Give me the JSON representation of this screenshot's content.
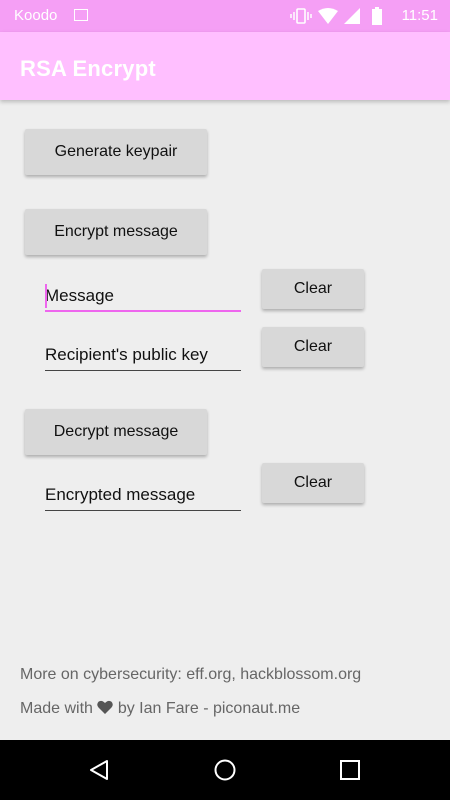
{
  "status_bar": {
    "carrier": "Koodo",
    "time": "11:51"
  },
  "app_bar": {
    "title": "RSA Encrypt"
  },
  "buttons": {
    "generate_keypair": "Generate keypair",
    "encrypt_message": "Encrypt message",
    "decrypt_message": "Decrypt message",
    "clear": "Clear"
  },
  "fields": {
    "message": "Message",
    "recipient_public_key": "Recipient's public key",
    "encrypted_message": "Encrypted message"
  },
  "footer": {
    "line1": "More on cybersecurity: eff.org, hackblossom.org",
    "line2_prefix": "Made with",
    "line2_suffix": "by Ian Fare - piconaut.me"
  },
  "colors": {
    "status_bar": "#f59ff5",
    "app_bar": "#ffbfff",
    "accent": "#ee66ee",
    "background": "#eeeeee"
  }
}
